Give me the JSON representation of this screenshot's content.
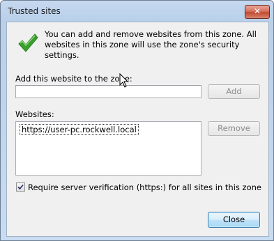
{
  "window": {
    "title": "Trusted sites",
    "close_glyph": "✕"
  },
  "intro": "You can add and remove websites from this zone. All websites in this zone will use the zone's security settings.",
  "icons": {
    "status": "checkmark-icon",
    "close": "close-icon"
  },
  "add_section": {
    "label": "Add this website to the zone:",
    "value": "",
    "add_button": "Add"
  },
  "websites_section": {
    "label": "Websites:",
    "items": [
      "https://user-pc.rockwell.local"
    ],
    "remove_button": "Remove"
  },
  "verification": {
    "label": "Require server verification (https:) for all sites in this zone",
    "checked": true
  },
  "footer": {
    "close_button": "Close"
  },
  "colors": {
    "accent_check": "#3aa02c",
    "close_red": "#c8543d",
    "focus_blue": "#3c7fb1"
  }
}
